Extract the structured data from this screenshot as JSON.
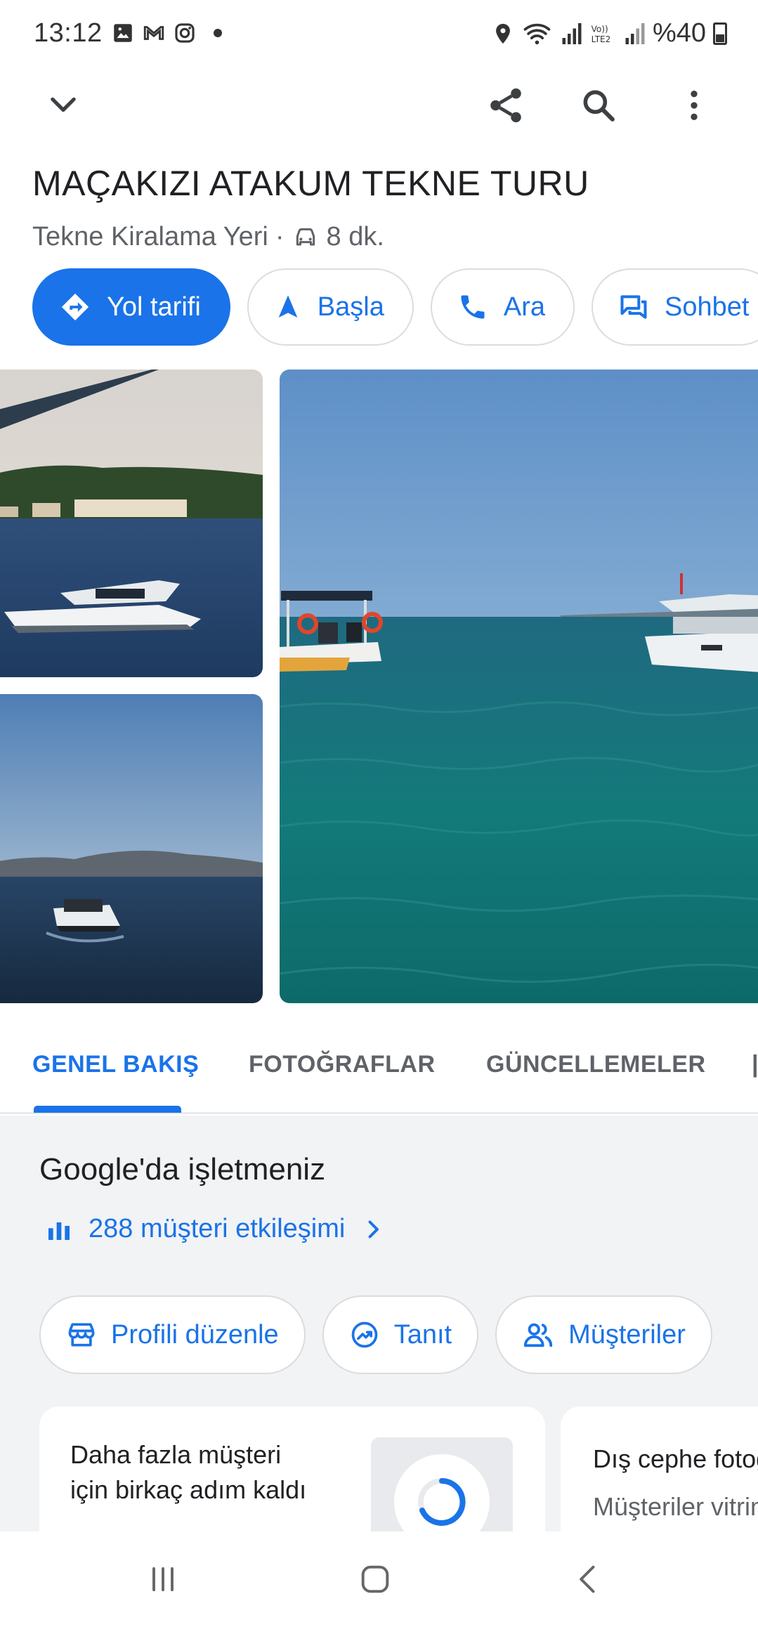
{
  "status_bar": {
    "time": "13:12",
    "battery": "%40",
    "icons": [
      "image-icon",
      "gmail-icon",
      "instagram-icon",
      "notification-dot",
      "location-icon",
      "wifi-icon",
      "signal-icon",
      "volte-lte2-icon",
      "signal-icon",
      "battery-icon"
    ]
  },
  "app_bar": {
    "icons": [
      "chevron-down-icon",
      "share-icon",
      "search-icon",
      "more-vert-icon"
    ]
  },
  "place": {
    "name": "MAÇAKIZI ATAKUM TEKNE TURU",
    "category": "Tekne Kiralama Yeri",
    "separator": "·",
    "drive_time": "8 dk."
  },
  "actions": [
    {
      "label": "Yol tarifi",
      "icon": "directions-icon"
    },
    {
      "label": "Başla",
      "icon": "navigation-arrow-icon"
    },
    {
      "label": "Ara",
      "icon": "phone-icon"
    },
    {
      "label": "Sohbet",
      "icon": "chat-icon"
    }
  ],
  "tabs": [
    {
      "label": "GENEL BAKIŞ",
      "active": true
    },
    {
      "label": "FOTOĞRAFLAR",
      "active": false
    },
    {
      "label": "GÜNCELLEMELER",
      "active": false
    }
  ],
  "business": {
    "title": "Google'da işletmeniz",
    "interactions_link": "288 müşteri etkileşimi",
    "chips": [
      {
        "label": "Profili düzenle",
        "icon": "store-icon"
      },
      {
        "label": "Tanıt",
        "icon": "trending-icon"
      },
      {
        "label": "Müşteriler",
        "icon": "people-icon"
      }
    ],
    "card1": {
      "line1": "Daha fazla müşteri",
      "line2": "için birkaç adım kaldı"
    },
    "card2": {
      "title": "Dış cephe fotoğrafları",
      "subtitle": "Müşteriler vitrini"
    }
  },
  "colors": {
    "accent": "#1a73e8",
    "text_primary": "#202124",
    "text_secondary": "#5f6368",
    "section_bg": "#f1f3f4"
  },
  "nav_bar": {
    "icons": [
      "recent-apps-icon",
      "home-icon",
      "back-icon"
    ]
  }
}
